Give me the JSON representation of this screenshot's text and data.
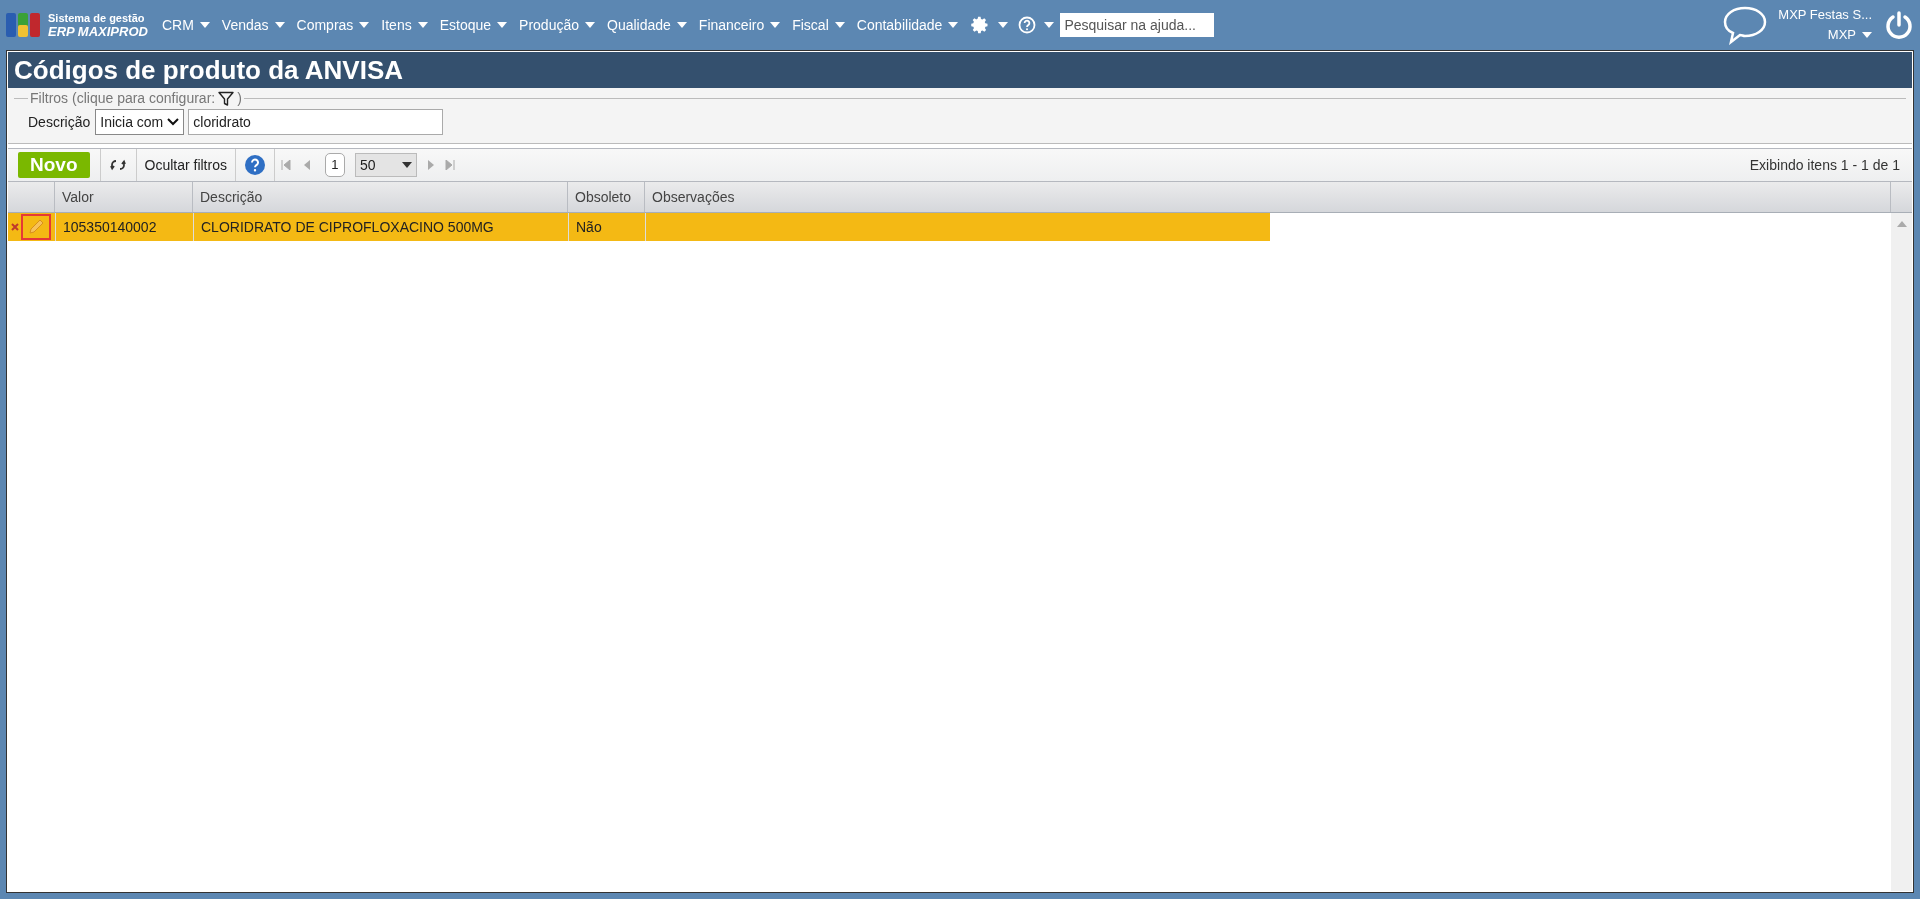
{
  "logo": {
    "line1": "Sistema de gestão",
    "line2": "ERP MAXIPROD"
  },
  "menu": [
    {
      "label": "CRM"
    },
    {
      "label": "Vendas"
    },
    {
      "label": "Compras"
    },
    {
      "label": "Itens"
    },
    {
      "label": "Estoque"
    },
    {
      "label": "Produção"
    },
    {
      "label": "Qualidade"
    },
    {
      "label": "Financeiro"
    },
    {
      "label": "Fiscal"
    },
    {
      "label": "Contabilidade"
    }
  ],
  "help_search": {
    "placeholder": "Pesquisar na ajuda..."
  },
  "user": {
    "company": "MXP Festas S...",
    "name": "MXP"
  },
  "page_title": "Códigos de produto da ANVISA",
  "filters": {
    "legend": "Filtros (clique para configurar:",
    "legend_end": ")",
    "field_label": "Descrição",
    "operator": "Inicia com",
    "value": "cloridrato"
  },
  "toolbar": {
    "new_button": "Novo",
    "hide_filters": "Ocultar filtros",
    "page": "1",
    "page_size": "50",
    "summary": "Exibindo itens 1 - 1 de 1"
  },
  "table": {
    "columns": [
      "Valor",
      "Descrição",
      "Obsoleto",
      "Observações"
    ],
    "rows": [
      {
        "selected": true,
        "cells": [
          "105350140002",
          "CLORIDRATO DE CIPROFLOXACINO 500MG",
          "Não",
          ""
        ]
      }
    ]
  }
}
